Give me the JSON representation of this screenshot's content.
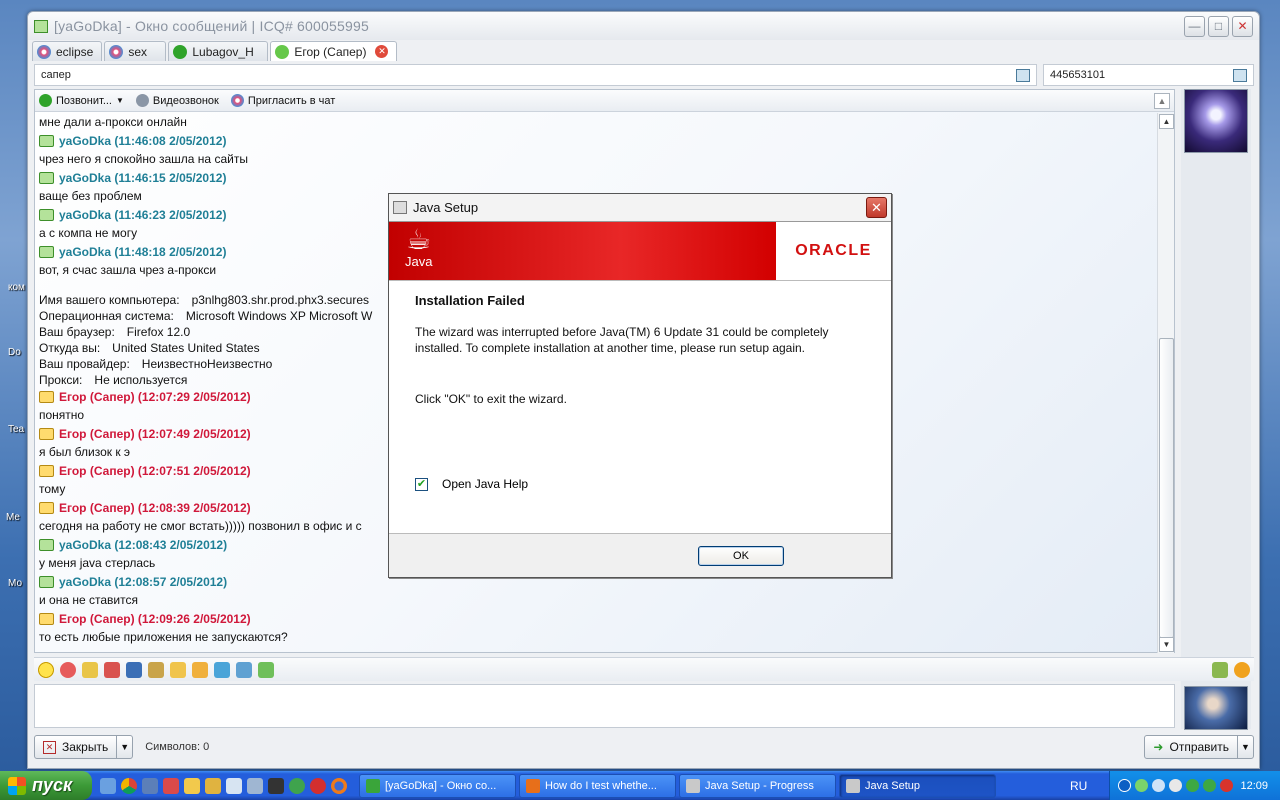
{
  "icq_window": {
    "title": "[yaGoDka] - Окно сообщений | ICQ# 600055995",
    "tabs": [
      {
        "label": "eclipse"
      },
      {
        "label": "sex"
      },
      {
        "label": "Lubagov_H"
      },
      {
        "label": "Егор (Сапер)",
        "active": true
      }
    ],
    "contact_nick": "сапер",
    "contact_uin": "445653101",
    "toolbar": {
      "call": "Позвонит...",
      "video": "Видеозвонок",
      "invite": "Пригласить в чат"
    },
    "messages": [
      {
        "kind": "text",
        "text": "мне дали а-прокси онлайн"
      },
      {
        "kind": "head",
        "who": "me",
        "text": "yaGoDka (11:46:08 2/05/2012)"
      },
      {
        "kind": "text",
        "text": "чрез него я спокойно зашла на сайты"
      },
      {
        "kind": "head",
        "who": "me",
        "text": "yaGoDka (11:46:15 2/05/2012)"
      },
      {
        "kind": "text",
        "text": "ваще без проблем"
      },
      {
        "kind": "head",
        "who": "me",
        "text": "yaGoDka (11:46:23 2/05/2012)"
      },
      {
        "kind": "text",
        "text": "а с компа не могу"
      },
      {
        "kind": "head",
        "who": "me",
        "text": "yaGoDka (11:48:18 2/05/2012)"
      },
      {
        "kind": "text",
        "text": "вот, я счас зашла чрез а-прокси"
      }
    ],
    "proxy_info": [
      {
        "k": "Имя вашего компьютера:",
        "v": "p3nlhg803.shr.prod.phx3.secures"
      },
      {
        "k": "Операционная система:",
        "v": "Microsoft Windows XP Microsoft W"
      },
      {
        "k": "Ваш браузер:",
        "v": "Firefox 12.0"
      },
      {
        "k": "Откуда вы:",
        "v": "United States United States"
      },
      {
        "k": "Ваш провайдер:",
        "v": "НеизвестноНеизвестно"
      },
      {
        "k": "Прокси:",
        "v": "Не используется"
      }
    ],
    "messages2": [
      {
        "kind": "head",
        "who": "them",
        "text": "Егор (Сапер) (12:07:29 2/05/2012)"
      },
      {
        "kind": "text",
        "text": "понятно"
      },
      {
        "kind": "head",
        "who": "them",
        "text": "Егор (Сапер) (12:07:49 2/05/2012)"
      },
      {
        "kind": "text",
        "text": "я был близок к э"
      },
      {
        "kind": "head",
        "who": "them",
        "text": "Егор (Сапер) (12:07:51 2/05/2012)"
      },
      {
        "kind": "text",
        "text": "тому"
      },
      {
        "kind": "head",
        "who": "them",
        "text": "Егор (Сапер) (12:08:39 2/05/2012)"
      },
      {
        "kind": "text",
        "text": "сегодня на работу не смог встать))))) позвонил в офис и с"
      },
      {
        "kind": "head",
        "who": "me",
        "text": "yaGoDka (12:08:43 2/05/2012)"
      },
      {
        "kind": "text",
        "text": "у меня java стерлась"
      },
      {
        "kind": "head",
        "who": "me",
        "text": "yaGoDka (12:08:57 2/05/2012)"
      },
      {
        "kind": "text",
        "text": "и она не ставится"
      },
      {
        "kind": "head",
        "who": "them",
        "text": "Егор (Сапер) (12:09:26 2/05/2012)"
      },
      {
        "kind": "text",
        "text": "то есть любые приложения не запускаются?"
      }
    ],
    "close_button": "Закрыть",
    "char_count_label": "Символов:",
    "char_count": "0",
    "send_button": "Отправить"
  },
  "java_dialog": {
    "title": "Java Setup",
    "java_logo_text": "Java",
    "oracle_logo_text": "ORACLE",
    "heading": "Installation Failed",
    "body": "The wizard was interrupted before Java(TM) 6 Update 31 could be completely installed.  To complete installation at another time, please run setup again.",
    "click_text": "Click \"OK\" to exit the wizard.",
    "checkbox_label": "Open Java Help",
    "checkbox_checked": true,
    "ok_button": "OK"
  },
  "taskbar": {
    "start": "пуск",
    "tasks": [
      {
        "label": "[yaGoDka] - Окно со...",
        "color": "#3aa53a"
      },
      {
        "label": "How do I test whethe...",
        "color": "#e76f1a"
      },
      {
        "label": "Java Setup - Progress",
        "color": "#c9c9c9"
      },
      {
        "label": "Java Setup",
        "color": "#c9c9c9",
        "active": true
      }
    ],
    "lang": "RU",
    "clock": "12:09"
  },
  "colors": {
    "accent_me": "#1f7f96",
    "accent_them": "#d0183a",
    "java_red": "#e82727"
  }
}
